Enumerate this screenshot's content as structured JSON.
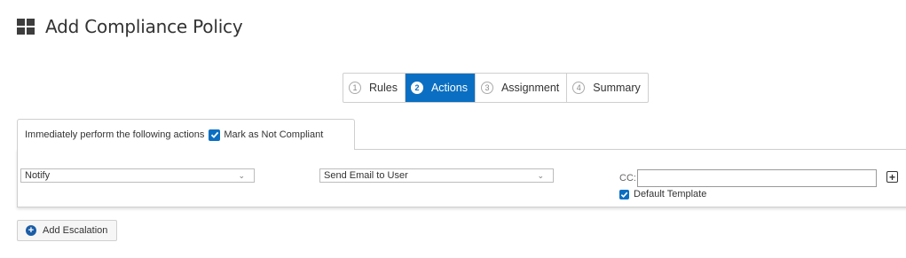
{
  "header": {
    "title": "Add Compliance Policy",
    "icon": "windows-icon"
  },
  "stepper": {
    "steps": [
      {
        "number": "1",
        "label": "Rules",
        "active": false
      },
      {
        "number": "2",
        "label": "Actions",
        "active": true
      },
      {
        "number": "3",
        "label": "Assignment",
        "active": false
      },
      {
        "number": "4",
        "label": "Summary",
        "active": false
      }
    ]
  },
  "tab": {
    "label": "Immediately perform the following actions",
    "checkbox_label": "Mark as Not Compliant",
    "checked": true
  },
  "action_row": {
    "action_select": {
      "value": "Notify"
    },
    "method_select": {
      "value": "Send Email to User"
    },
    "cc": {
      "label": "CC:",
      "value": "",
      "placeholder": ""
    },
    "default_template": {
      "label": "Default Template",
      "checked": true
    }
  },
  "add_escalation": {
    "label": "Add Escalation"
  },
  "colors": {
    "accent": "#0a6fc2",
    "border": "#cfcfcf",
    "text": "#333333"
  }
}
